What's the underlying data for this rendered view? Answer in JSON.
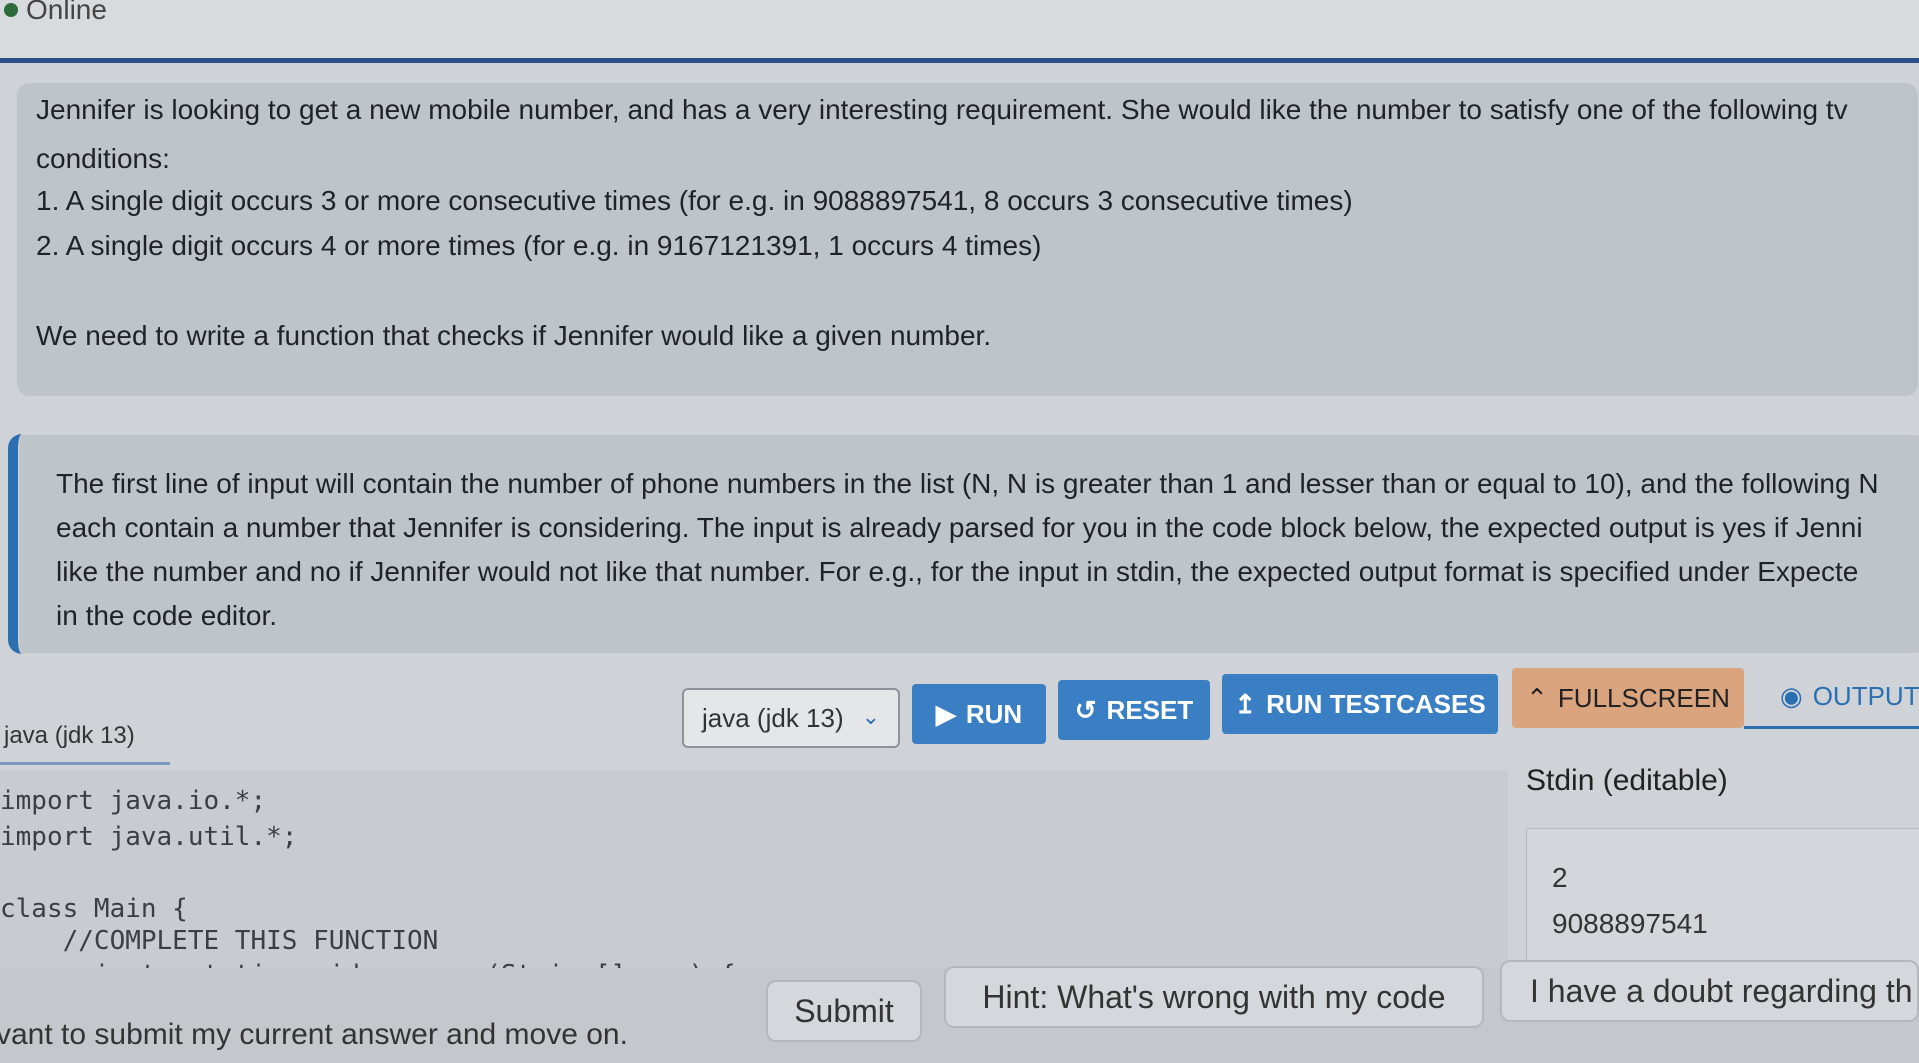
{
  "header": {
    "status": "Online"
  },
  "problem": {
    "line1": "Jennifer is looking to get a new mobile number, and has a very interesting requirement. She would like the number to satisfy one of the following tv",
    "line2": "conditions:",
    "condition1": "1. A single digit occurs 3 or more consecutive times (for e.g. in 9088897541, 8 occurs 3 consecutive times)",
    "condition2": "2. A single digit occurs 4 or more times (for e.g. in 9167121391, 1 occurs 4 times)",
    "task": "We need to write a function that checks if Jennifer would like a given number."
  },
  "input_desc": {
    "line1": "The first line of input will contain the number of phone numbers in the list (N, N is greater than 1 and lesser than or equal to 10), and the following N",
    "line2": "each contain a number that Jennifer is considering. The input is already parsed for you in the code block below, the expected output is yes if Jenni",
    "line3": "like the number and no if Jennifer would not like that number. For e.g., for the input in stdin, the expected output format is specified under Expecte",
    "line4": "in the code editor."
  },
  "toolbar": {
    "language_label": "java (jdk 13)",
    "language_select": "java (jdk 13)",
    "run": "RUN",
    "reset": "RESET",
    "run_testcases": "RUN TESTCASES",
    "fullscreen": "FULLSCREEN",
    "output": "OUTPUT"
  },
  "code": {
    "lines": [
      "import java.io.*;",
      "import java.util.*;",
      "",
      "class Main {",
      "    //COMPLETE THIS FUNCTION",
      "    private static void process(String[] arr) {"
    ]
  },
  "stdin": {
    "title": "Stdin (editable)",
    "lines": [
      "2",
      "9088897541"
    ]
  },
  "bottom": {
    "text": "vant to submit my current answer and move on.",
    "submit": "Submit",
    "hint": "Hint: What's wrong with my code",
    "doubt": "I have a doubt regarding th"
  },
  "colors": {
    "accent": "#3a7fc4",
    "fullscreen": "#d9a47e",
    "header_rule": "#2f4f8a"
  }
}
